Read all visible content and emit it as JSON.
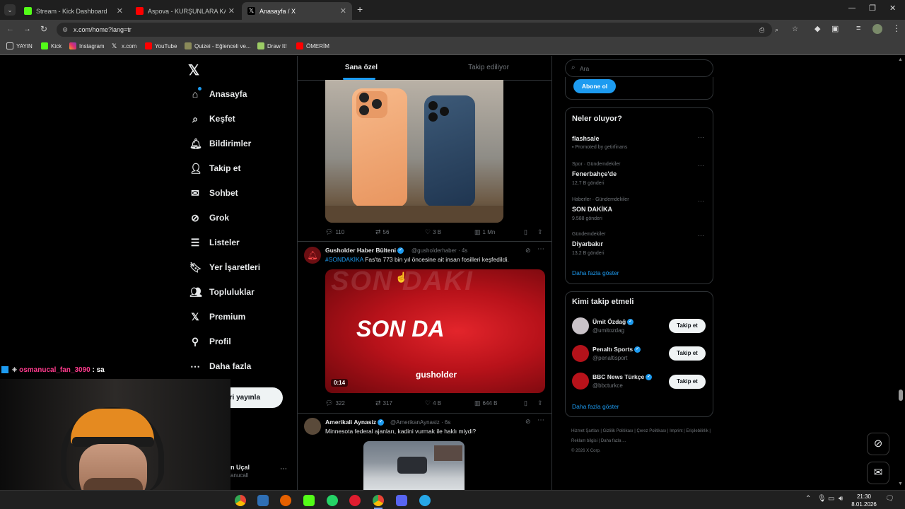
{
  "browser": {
    "tabs": [
      {
        "title": "Stream - Kick Dashboard",
        "active": false
      },
      {
        "title": "Aspova - KURŞUNLARA KAFA (...",
        "active": false
      },
      {
        "title": "Anasayfa / X",
        "active": true
      }
    ],
    "url": "x.com/home?lang=tr",
    "bookmarks": [
      "YAYIN",
      "Kick",
      "Instagram",
      "x.com",
      "YouTube",
      "Quizei - Eğlenceli ve...",
      "Draw It!",
      "ÖMERİM"
    ]
  },
  "nav": {
    "items": [
      "Anasayfa",
      "Keşfet",
      "Bildirimler",
      "Takip et",
      "Sohbet",
      "Grok",
      "Listeler",
      "Yer İşaretleri",
      "Topluluklar",
      "Premium",
      "Profil",
      "Daha fazla"
    ],
    "post_button": "ri yayınla",
    "account_name": "n Uçal",
    "account_handle": "anucall"
  },
  "feed": {
    "tabs": [
      "Sana özel",
      "Takip ediliyor"
    ],
    "post1_actions": {
      "replies": "110",
      "reposts": "56",
      "likes": "3 B",
      "views": "1 Mn"
    },
    "post2": {
      "author": "Gusholder Haber Bülteni",
      "handle": "@gusholderhaber · 4s",
      "hashtag": "#SONDAKİKA",
      "text": " Fas'ta 773 bin yıl öncesine ait insan fosilleri keşfedildi.",
      "media_text": "SON DA",
      "media_bg_text": "SON DAKI",
      "media_logo": "gusholder",
      "duration": "0:14",
      "replies": "322",
      "reposts": "317",
      "likes": "4 B",
      "views": "644 B"
    },
    "post3": {
      "author": "Amerikali Aynasiz",
      "handle": "@AmerikanAynasiz · 6s",
      "text": "Minnesota federal ajanları, kadini vurmak ile haklı miydi?"
    }
  },
  "sidebar": {
    "search_placeholder": "Ara",
    "subscribe_button": "Abone ol",
    "trends_title": "Neler oluyor?",
    "trends": [
      {
        "category": "",
        "name": "flashsale",
        "count": "Promoted by getirfinans"
      },
      {
        "category": "Spor · Gündemdekiler",
        "name": "Fenerbahçe'de",
        "count": "12,7 B gönderi"
      },
      {
        "category": "Haberler · Gündemdekiler",
        "name": "SON DAKİKA",
        "count": "9.588 gönderi"
      },
      {
        "category": "Gündemdekiler",
        "name": "Diyarbakır",
        "count": "13,2 B gönderi"
      }
    ],
    "show_more": "Daha fazla göster",
    "who_to_follow_title": "Kimi takip etmeli",
    "follow_suggestions": [
      {
        "name": "Ümit Özdağ",
        "handle": "@umitozdag",
        "button": "Takip et"
      },
      {
        "name": "Penaltı Sports",
        "handle": "@penaltisport",
        "button": "Takip et"
      },
      {
        "name": "BBC News Türkçe",
        "handle": "@bbcturkce",
        "button": "Takip et"
      }
    ],
    "footer_links": [
      "Hizmet Şartları",
      "Gizlilik Politikası",
      "Çerez Politikası",
      "Imprint",
      "Erişilebilirlik",
      "Reklam bilgisi",
      "Daha fazla ..."
    ],
    "copyright": "© 2026 X Corp."
  },
  "overlay": {
    "chat_user": "osmanucal_fan_3090",
    "chat_message": ": sa"
  },
  "taskbar": {
    "time": "21:30",
    "date": "8.01.2026"
  },
  "colors": {
    "accent": "#1d9bf0",
    "news_red": "#c4141b",
    "chat_user": "#ff3b8d"
  }
}
